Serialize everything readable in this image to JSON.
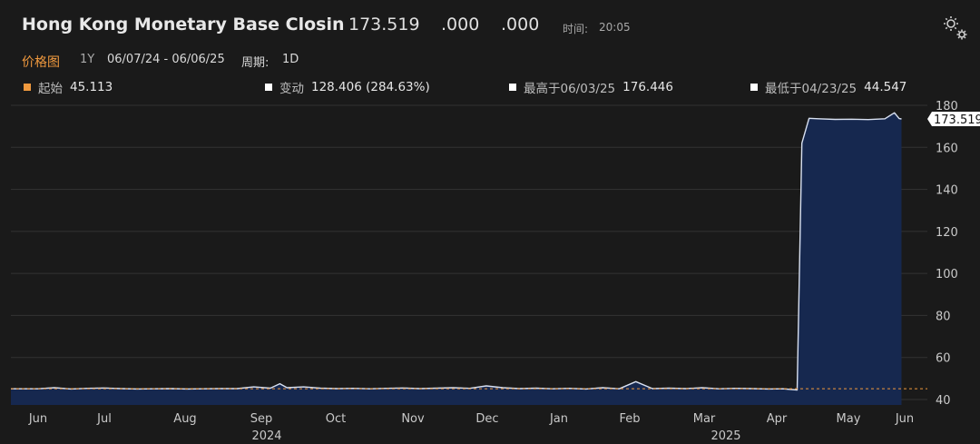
{
  "header": {
    "title": "Hong Kong Monetary Base Closin",
    "last": "173.519",
    "change": ".000",
    "change_pct": ".000",
    "time_label": "时间:",
    "time_value": "20:05"
  },
  "subbar": {
    "tab": "价格图",
    "range": "1Y",
    "dates": "06/07/24 - 06/06/25",
    "period_label": "周期:",
    "period_value": "1D"
  },
  "stats": {
    "start_label": "起始",
    "start_value": "45.113",
    "change_label": "变动",
    "change_value": "128.406 (284.63%)",
    "high_label": "最高于06/03/25",
    "high_value": "176.446",
    "low_label": "最低于04/23/25",
    "low_value": "44.547"
  },
  "colors": {
    "background": "#1a1a1a",
    "area_fill": "#16284f",
    "line": "#d8e0f0",
    "accent": "#f0993e",
    "grid": "#333333"
  },
  "icons": {
    "settings": "gear-icon"
  },
  "chart_data": {
    "type": "area",
    "title": "Hong Kong Monetary Base Closin",
    "x_tick_labels": [
      "Jun",
      "Jul",
      "Aug",
      "Sep",
      "Oct",
      "Nov",
      "Dec",
      "Jan",
      "Feb",
      "Mar",
      "Apr",
      "May",
      "Jun"
    ],
    "year_labels": [
      "2024",
      "2025"
    ],
    "y_ticks": [
      40,
      60,
      80,
      100,
      120,
      140,
      160,
      180
    ],
    "ylim": [
      40,
      180
    ],
    "last_value_label": "173.519",
    "reference_line": 45.113,
    "grid": true,
    "x": [
      "2024-06-07",
      "2024-06-14",
      "2024-06-21",
      "2024-06-28",
      "2024-07-05",
      "2024-07-12",
      "2024-07-19",
      "2024-07-26",
      "2024-08-02",
      "2024-08-09",
      "2024-08-16",
      "2024-08-23",
      "2024-08-30",
      "2024-09-06",
      "2024-09-13",
      "2024-09-17",
      "2024-09-20",
      "2024-09-27",
      "2024-10-04",
      "2024-10-11",
      "2024-10-18",
      "2024-10-25",
      "2024-11-01",
      "2024-11-08",
      "2024-11-15",
      "2024-11-22",
      "2024-11-29",
      "2024-12-06",
      "2024-12-13",
      "2024-12-20",
      "2024-12-27",
      "2025-01-03",
      "2025-01-10",
      "2025-01-17",
      "2025-01-24",
      "2025-01-31",
      "2025-02-07",
      "2025-02-14",
      "2025-02-21",
      "2025-02-28",
      "2025-03-07",
      "2025-03-14",
      "2025-03-21",
      "2025-03-28",
      "2025-04-04",
      "2025-04-11",
      "2025-04-17",
      "2025-04-23",
      "2025-04-25",
      "2025-04-28",
      "2025-05-02",
      "2025-05-09",
      "2025-05-16",
      "2025-05-23",
      "2025-05-30",
      "2025-06-03",
      "2025-06-05",
      "2025-06-06"
    ],
    "values": [
      45.113,
      45.6,
      45.0,
      45.3,
      45.5,
      45.2,
      45.0,
      45.1,
      45.2,
      45.0,
      45.1,
      45.2,
      45.2,
      46.0,
      45.4,
      47.5,
      45.6,
      46.0,
      45.4,
      45.2,
      45.3,
      45.1,
      45.3,
      45.5,
      45.2,
      45.4,
      45.6,
      45.3,
      46.5,
      45.6,
      45.2,
      45.4,
      45.1,
      45.3,
      45.0,
      45.6,
      45.1,
      48.5,
      45.2,
      45.4,
      45.2,
      45.6,
      45.1,
      45.3,
      45.2,
      45.0,
      45.1,
      44.547,
      162.0,
      173.8,
      173.6,
      173.3,
      173.4,
      173.2,
      173.6,
      176.446,
      173.7,
      173.519
    ]
  }
}
